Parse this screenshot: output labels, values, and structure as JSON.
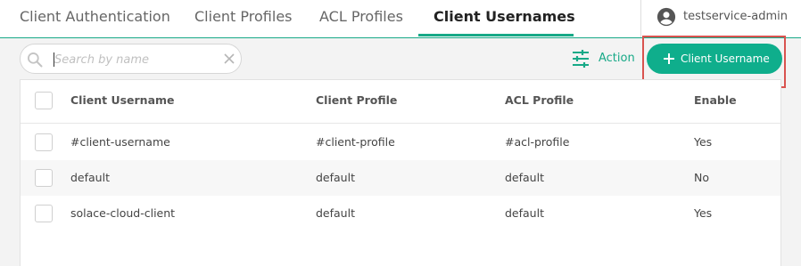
{
  "tabs": [
    {
      "label": "Client Authentication",
      "active": false
    },
    {
      "label": "Client Profiles",
      "active": false
    },
    {
      "label": "ACL Profiles",
      "active": false
    },
    {
      "label": "Client Usernames",
      "active": true
    }
  ],
  "user": {
    "name": "testservice-admin",
    "icon": "account-circle-icon"
  },
  "toolbar": {
    "search_placeholder": "Search by name",
    "search_value": "",
    "action_label": "Action",
    "add_label": "Client Username"
  },
  "table": {
    "columns": [
      "Client Username",
      "Client Profile",
      "ACL Profile",
      "Enable"
    ],
    "rows": [
      {
        "username": "#client-username",
        "client_profile": "#client-profile",
        "acl_profile": "#acl-profile",
        "enable": "Yes"
      },
      {
        "username": "default",
        "client_profile": "default",
        "acl_profile": "default",
        "enable": "No"
      },
      {
        "username": "solace-cloud-client",
        "client_profile": "default",
        "acl_profile": "default",
        "enable": "Yes"
      }
    ]
  },
  "colors": {
    "accent": "#17a987",
    "primary_button": "#0fae8c",
    "highlight": "#d9534f"
  }
}
